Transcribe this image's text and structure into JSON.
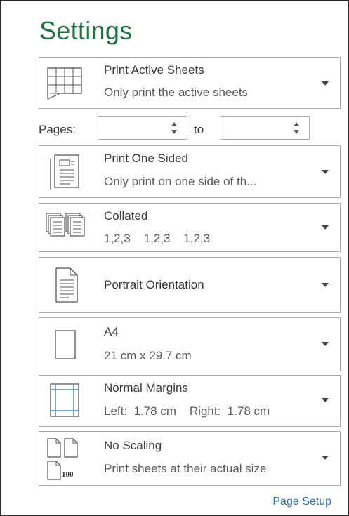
{
  "settings": {
    "title": "Settings",
    "print_what": {
      "label": "Print Active Sheets",
      "desc": "Only print the active sheets",
      "icon": "sheets-grid-icon"
    },
    "pages": {
      "label": "Pages:",
      "from_value": "",
      "to_label": "to",
      "to_value": ""
    },
    "sides": {
      "label": "Print One Sided",
      "desc": "Only print on one side of th...",
      "icon": "one-sided-page-icon"
    },
    "collation": {
      "label": "Collated",
      "desc": "1,2,3    1,2,3    1,2,3",
      "icon": "collated-pages-icon"
    },
    "orientation": {
      "label": "Portrait Orientation",
      "icon": "portrait-page-icon"
    },
    "paper": {
      "label": "A4",
      "desc": "21 cm x 29.7 cm",
      "icon": "paper-size-icon"
    },
    "margins": {
      "label": "Normal Margins",
      "desc": "Left:  1.78 cm    Right:  1.78 cm",
      "icon": "margins-icon"
    },
    "scaling": {
      "label": "No Scaling",
      "desc": "Print sheets at their actual size",
      "icon": "scaling-icon",
      "icon_text": "100"
    },
    "page_setup_link": "Page Setup"
  },
  "colors": {
    "title": "#217346",
    "link": "#2e6fb7",
    "border": "#ababab"
  }
}
